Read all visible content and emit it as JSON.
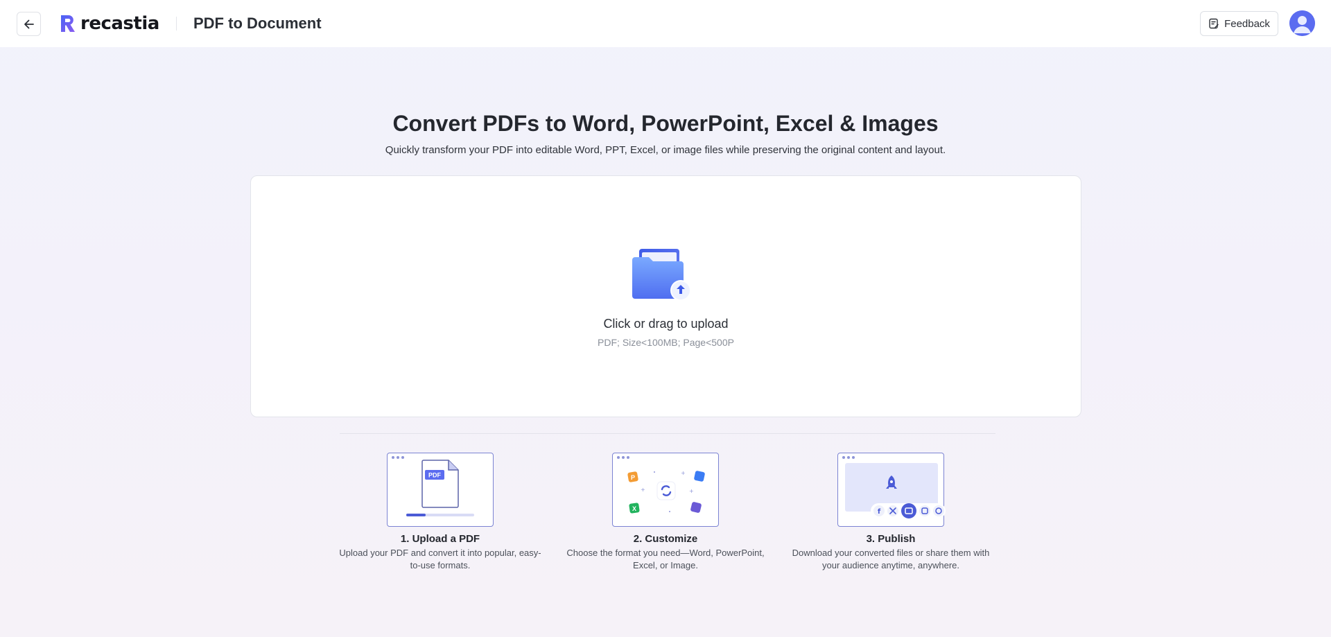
{
  "header": {
    "logo_text": "recastia",
    "page_title": "PDF to Document",
    "feedback_label": "Feedback"
  },
  "hero": {
    "title": "Convert PDFs to Word, PowerPoint, Excel & Images",
    "subtitle": "Quickly transform your PDF into editable Word, PPT, Excel, or image files while preserving the original content and layout."
  },
  "upload": {
    "label": "Click or drag to upload",
    "hint": "PDF; Size<100MB; Page<500P"
  },
  "steps": [
    {
      "title": "1. Upload a PDF",
      "desc_line1": "Upload your PDF and convert it into popular, easy-",
      "desc_line2": "to-use formats.",
      "badge": "PDF"
    },
    {
      "title": "2. Customize",
      "desc_line1": "Choose the format you need—Word, PowerPoint,",
      "desc_line2": "Excel, or Image."
    },
    {
      "title": "3. Publish",
      "desc_line1": "Download your converted files or share them with",
      "desc_line2": "your audience anytime, anywhere."
    }
  ],
  "colors": {
    "accent": "#5b6cf0",
    "illustration_border": "#7b83d3"
  },
  "icons": {
    "back": "arrow-left-icon",
    "feedback": "feedback-note-icon",
    "upload": "folder-upload-icon",
    "avatar": "user-avatar-icon"
  }
}
